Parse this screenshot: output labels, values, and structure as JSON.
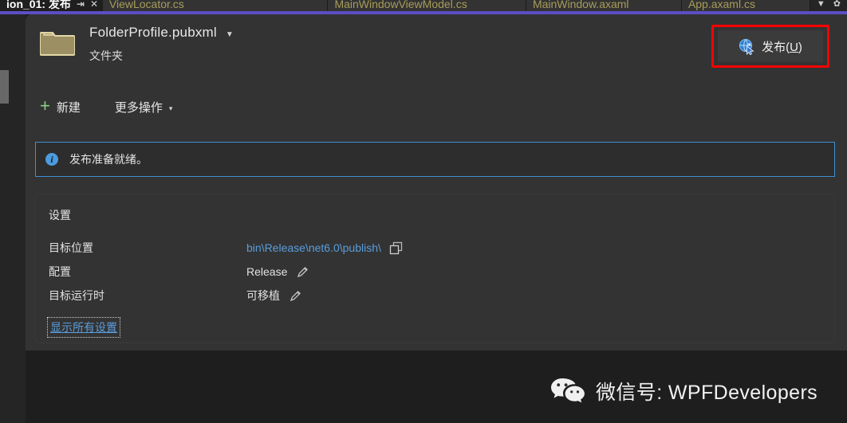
{
  "tabs": [
    {
      "label": "ion_01: 发布",
      "active": true,
      "pin_icon": "pin-icon",
      "close_icon": "close-icon"
    },
    {
      "label": "ViewLocator.cs",
      "active": false
    },
    {
      "label": "MainWindowViewModel.cs",
      "active": false
    },
    {
      "label": "MainWindow.axaml",
      "active": false
    },
    {
      "label": "App.axaml.cs",
      "active": false
    }
  ],
  "tab_controls": {
    "overflow_icon": "chevron-down-icon",
    "overflow_glyph": "▼",
    "settings_icon": "gear-icon",
    "settings_glyph": "✿"
  },
  "profile": {
    "icon": "folder-icon",
    "name": "FolderProfile.pubxml",
    "caret": "▼",
    "type": "文件夹"
  },
  "publish_button": {
    "icon": "publish-globe-icon",
    "label_prefix": "发布(",
    "accel": "U",
    "label_suffix": ")",
    "highlight_color": "#ff0000"
  },
  "toolbar": {
    "new_label": "新建",
    "new_plus": "+",
    "more_label": "更多操作",
    "more_caret": "▾"
  },
  "info_bar": {
    "icon": "info-icon",
    "glyph": "i",
    "message": "发布准备就绪。",
    "border_color": "#3f8fd4"
  },
  "settings": {
    "title": "设置",
    "rows": [
      {
        "label": "目标位置",
        "value": "bin\\Release\\net6.0\\publish\\",
        "is_link": true,
        "action_icon": "copy-icon"
      },
      {
        "label": "配置",
        "value": "Release",
        "is_link": false,
        "action_icon": "pencil-icon"
      },
      {
        "label": "目标运行时",
        "value": "可移植",
        "is_link": false,
        "action_icon": "pencil-icon"
      }
    ],
    "show_all_label": "显示所有设置"
  },
  "watermark": {
    "icon": "wechat-icon",
    "text": "微信号: WPFDevelopers"
  },
  "colors": {
    "accent_line": "#5b4ec4",
    "panel_bg": "#333333",
    "shell_bg": "#1e1e1e",
    "link": "#5a9ddb",
    "plus_green": "#89d185"
  }
}
